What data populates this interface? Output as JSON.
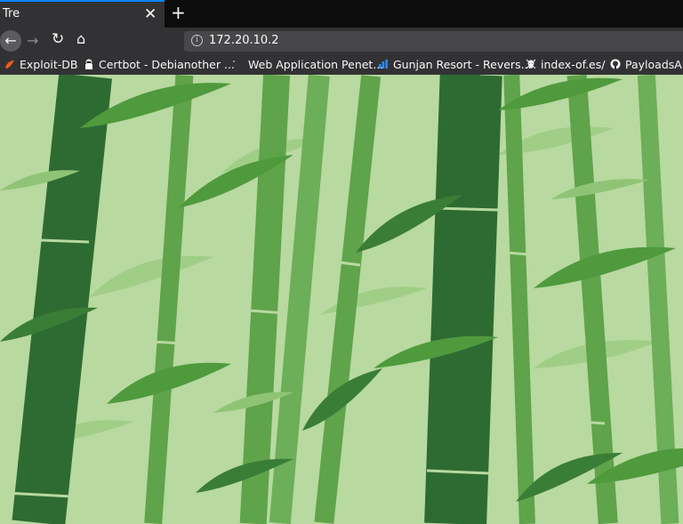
{
  "tab": {
    "title": "Tre",
    "close": "✕",
    "new_tab": "+"
  },
  "nav": {
    "back": "←",
    "forward": "→",
    "reload": "↻",
    "home": "⌂"
  },
  "address": {
    "url": "172.20.10.2",
    "info": "i"
  },
  "bookmarks": [
    {
      "label": "Exploit-DB",
      "icon": "exploitdb-icon"
    },
    {
      "label": "Certbot - Debianother ...",
      "icon": "certbot-icon"
    },
    {
      "label": "Web Application Penet...",
      "icon": "page-icon"
    },
    {
      "label": "Gunjan Resort - Revers...",
      "icon": "bars-icon"
    },
    {
      "label": "index-of.es/",
      "icon": "skull-icon"
    },
    {
      "label": "PayloadsAll",
      "icon": "github-icon"
    }
  ],
  "colors": {
    "accent": "#0a84ff",
    "chrome": "#323234",
    "background": "#b8d9a0"
  }
}
